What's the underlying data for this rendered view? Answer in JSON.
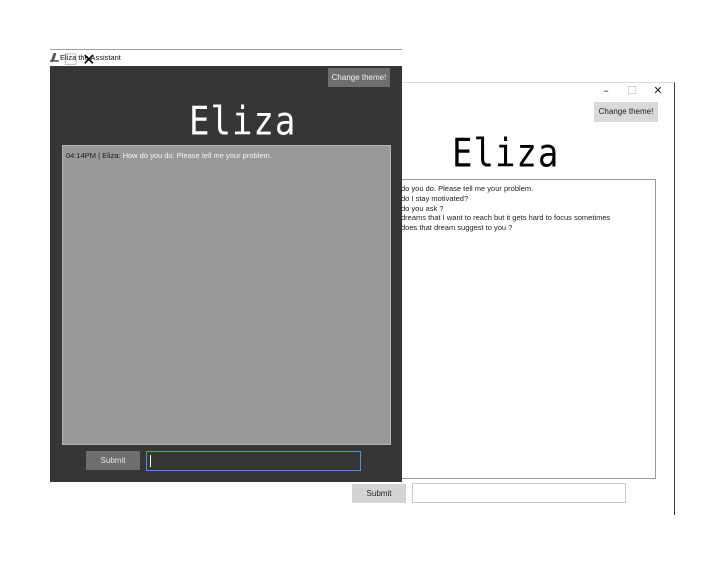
{
  "dark_window": {
    "title": "Eliza the Assistant",
    "controls": {
      "minimize": "–",
      "maximize": "☐",
      "close": "✕"
    },
    "theme_button": "Change theme!",
    "heading": "Eliza",
    "messages": [
      {
        "time": "04:14PM",
        "separator": " | ",
        "speaker": "Eliza",
        "colon": ":",
        "text": " How do you do.  Please tell me your problem."
      }
    ],
    "submit_label": "Submit",
    "input_value": "",
    "colors": {
      "background": "#363636",
      "chat": "#999999",
      "focus": "#4f8fe6"
    }
  },
  "light_window": {
    "controls": {
      "minimize": "–",
      "maximize": "☐",
      "close": "✕"
    },
    "theme_button": "Change theme!",
    "heading": "Eliza",
    "chat_lines": [
      "do you do.  Please tell me your problem.",
      "do I stay motivated?",
      "do you ask ?",
      "dreams that I want to reach but it gets hard to focus sometimes",
      "does that dream suggest to you ?"
    ],
    "submit_label": "Submit",
    "input_value": ""
  },
  "icons": {
    "app": "feather-icon"
  }
}
